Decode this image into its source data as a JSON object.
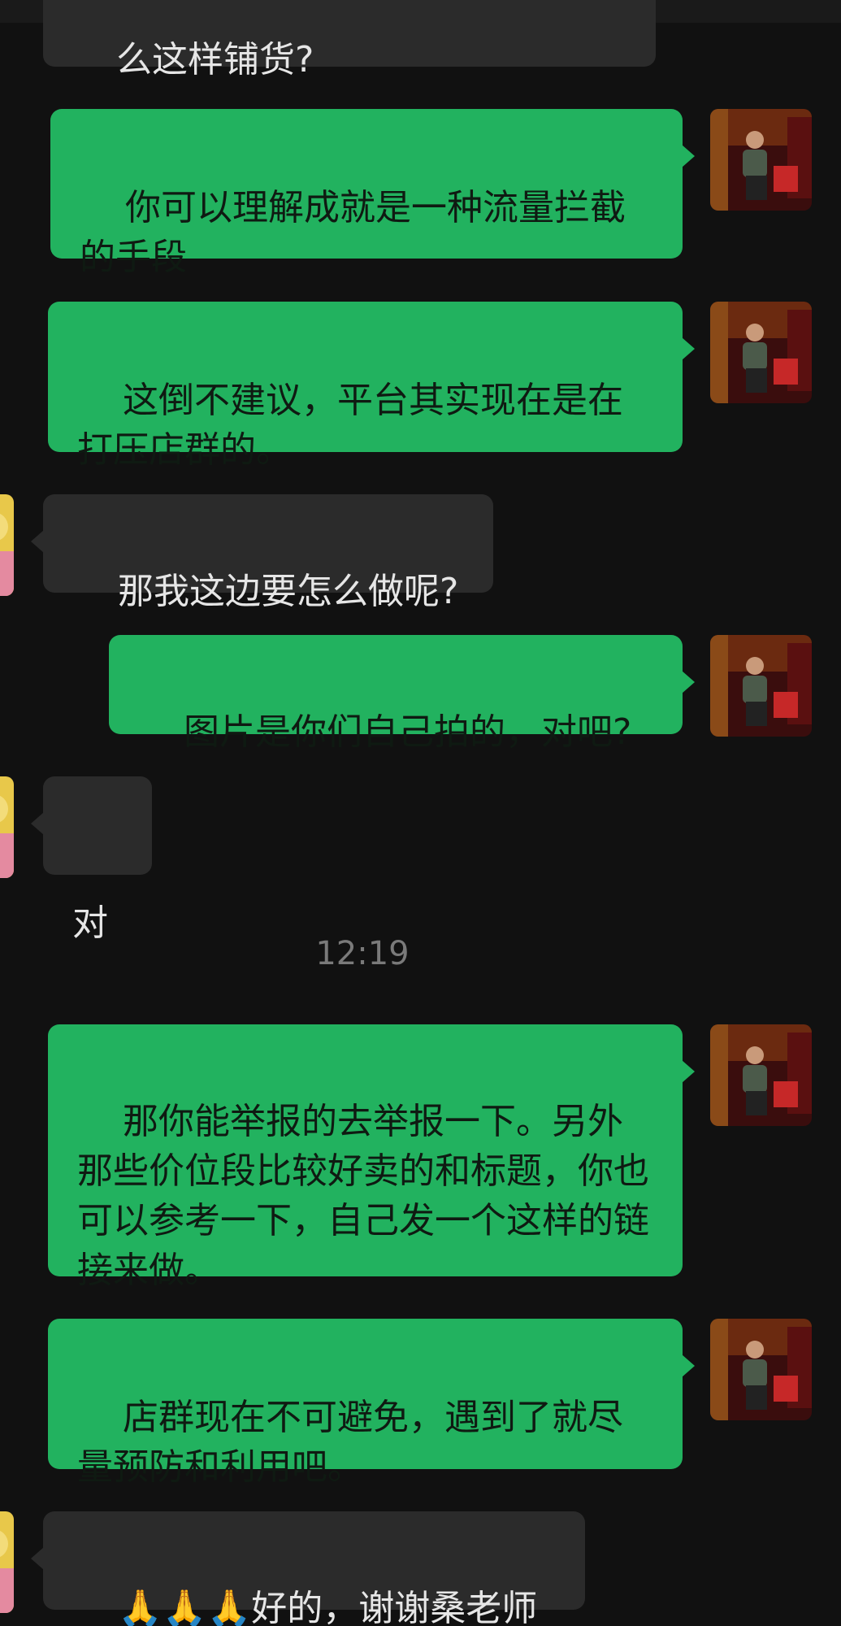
{
  "chat": {
    "messages": [
      {
        "side": "in",
        "text": "么这样铺货?"
      },
      {
        "side": "out",
        "text": "你可以理解成就是一种流量拦截的手段"
      },
      {
        "side": "out",
        "text": "这倒不建议，平台其实现在是在打压店群的。"
      },
      {
        "side": "in",
        "text": "那我这边要怎么做呢?"
      },
      {
        "side": "out",
        "text": "图片是你们自己拍的，对吧?"
      },
      {
        "side": "in",
        "text": "对"
      },
      {
        "side": "out",
        "text": "那你能举报的去举报一下。另外那些价位段比较好卖的和标题，你也可以参考一下，自己发一个这样的链接来做。"
      },
      {
        "side": "out",
        "text": "店群现在不可避免，遇到了就尽量预防和利用吧。"
      },
      {
        "side": "in",
        "text": "🙏🙏🙏好的，谢谢桑老师"
      }
    ],
    "timestamp": "12:19"
  },
  "avatars": {
    "self_icon": "user-portrait-icon",
    "other_icon": "contact-portrait-icon"
  },
  "colors": {
    "background": "#111111",
    "outgoing_bubble": "#22b25f",
    "incoming_bubble": "#2b2b2b"
  }
}
